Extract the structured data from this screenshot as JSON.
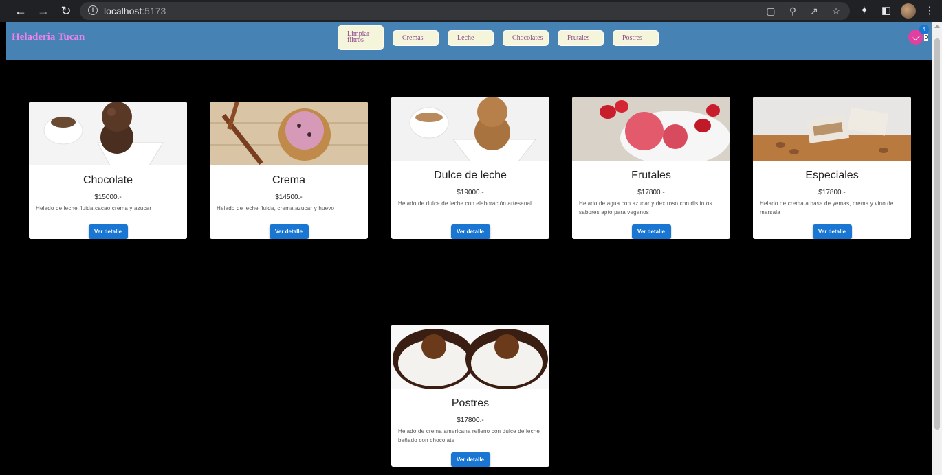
{
  "browser": {
    "url_host": "localhost",
    "url_port": ":5173"
  },
  "navbar": {
    "brand": "Heladeria Tucan",
    "filters": [
      "Limpiar filtros",
      "Cremas",
      "Leche",
      "Chocolates",
      "Frutales",
      "Postres"
    ],
    "cart_badge": "4",
    "cart_count": "0"
  },
  "products": [
    {
      "name": "Chocolate",
      "price": "$15000.-",
      "description": "Helado de leche fluida,cacao,crema y azucar",
      "button": "Ver detalle"
    },
    {
      "name": "Crema",
      "price": "$14500.-",
      "description": "Helado de leche fluida, crema,azucar y huevo",
      "button": "Ver detalle"
    },
    {
      "name": "Dulce de leche",
      "price": "$19000.-",
      "description": "Helado de dulce de leche con elaboración artesanal",
      "button": "Ver detalle"
    },
    {
      "name": "Frutales",
      "price": "$17800.-",
      "description": "Helado de agua con azucar y dextroso con distintos sabores apto para veganos",
      "button": "Ver detalle"
    },
    {
      "name": "Especiales",
      "price": "$17800.-",
      "description": "Helado de crema a base de yemas, crema y vino de marsala",
      "button": "Ver detalle"
    },
    {
      "name": "Postres",
      "price": "$17800.-",
      "description": "Helado de crema americana relleno con dulce de leche bañado con chocolate",
      "button": "Ver detalle"
    }
  ],
  "colors": {
    "navbar": "#4682b4",
    "brand": "#ee82ee",
    "filter_bg": "#f5f5dc",
    "button": "#1976d2",
    "page_bg": "#000000"
  }
}
